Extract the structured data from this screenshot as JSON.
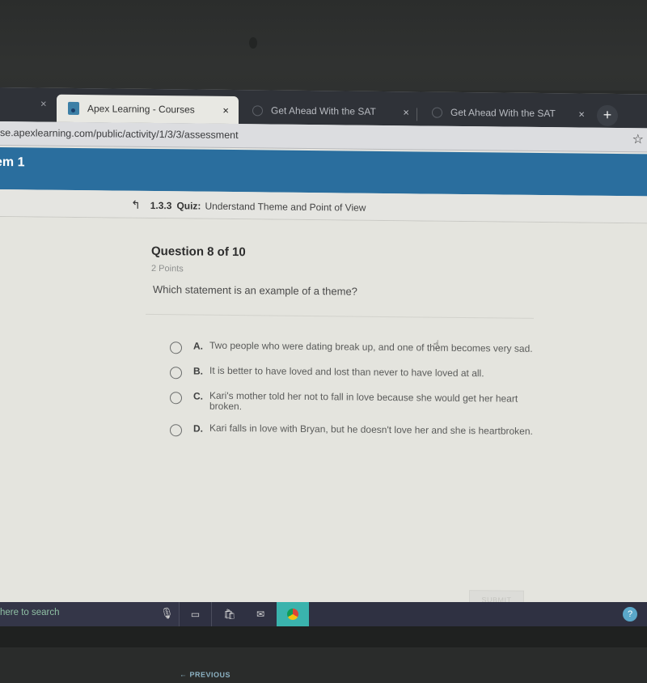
{
  "browser": {
    "tabs": [
      {
        "label": "Apex Learning - Courses",
        "active": true,
        "icon": "apex-favicon"
      },
      {
        "label": "Get Ahead With the SAT",
        "active": false,
        "icon": "globe-icon"
      },
      {
        "label": "Get Ahead With the SAT",
        "active": false,
        "icon": "globe-icon"
      }
    ],
    "close_glyph": "×",
    "new_tab_glyph": "+",
    "url": "se.apexlearning.com/public/activity/1/3/3/assessment",
    "bookmark_glyph": "☆"
  },
  "header": {
    "title": "em 1"
  },
  "breadcrumb": {
    "up_glyph": "↰",
    "number": "1.3.3",
    "kind": "Quiz:",
    "title": "Understand Theme and Point of View"
  },
  "question": {
    "number_label": "Question 8 of 10",
    "points": "2 Points",
    "prompt": "Which statement is an example of a theme?",
    "choices": [
      {
        "letter": "A.",
        "text": "Two people who were dating break up, and one of them becomes very sad."
      },
      {
        "letter": "B.",
        "text": "It is better to have loved and lost than never to have loved at all."
      },
      {
        "letter": "C.",
        "text": "Kari's mother told her not to fall in love because she would get her heart broken."
      },
      {
        "letter": "D.",
        "text": "Kari falls in love with Bryan, but he doesn't love her and she is heartbroken."
      }
    ],
    "selected": null,
    "submit_label": "SUBMIT",
    "previous_label": "← PREVIOUS"
  },
  "taskbar": {
    "search_text": "here to search",
    "mic_glyph": "🎙",
    "taskview_glyph": "▭",
    "store_glyph": "🛍",
    "mail_glyph": "✉",
    "help_glyph": "?"
  },
  "cursor_glyph": "☝"
}
